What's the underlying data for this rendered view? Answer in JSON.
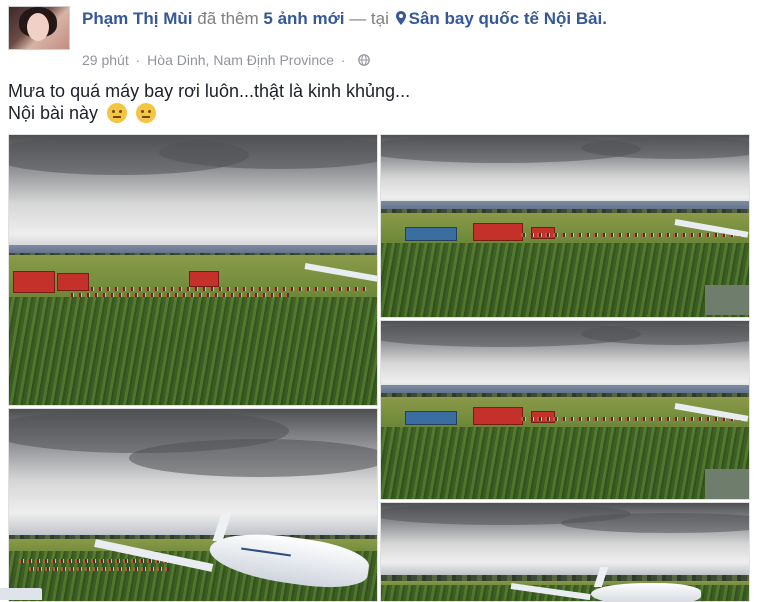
{
  "post": {
    "author_name": "Phạm Thị Mùi",
    "action_text": "đã thêm",
    "photo_count_text": "5 ảnh mới",
    "separator_text": "— tại",
    "location_name": "Sân bay quốc tế Nội Bài.",
    "meta": {
      "time": "29 phút",
      "place": "Hòa Dinh, Nam Định Province",
      "separator": "·"
    },
    "status_lines": [
      "Mưa to quá máy bay rơi luôn...thật là kinh khủng...",
      "Nội bài này"
    ]
  },
  "photos": [
    {
      "id": "photo-1",
      "scene": "rescue-field"
    },
    {
      "id": "photo-2",
      "scene": "rescue-field"
    },
    {
      "id": "photo-3",
      "scene": "rescue-field"
    },
    {
      "id": "photo-4",
      "scene": "crashed-plane"
    },
    {
      "id": "photo-5",
      "scene": "crashed-plane"
    }
  ],
  "icons": {
    "location": "map-pin-icon",
    "privacy": "globe-icon",
    "emoji": "confused-face-icon"
  },
  "colors": {
    "link": "#365899",
    "meta": "#90949c",
    "text": "#1d2129"
  }
}
